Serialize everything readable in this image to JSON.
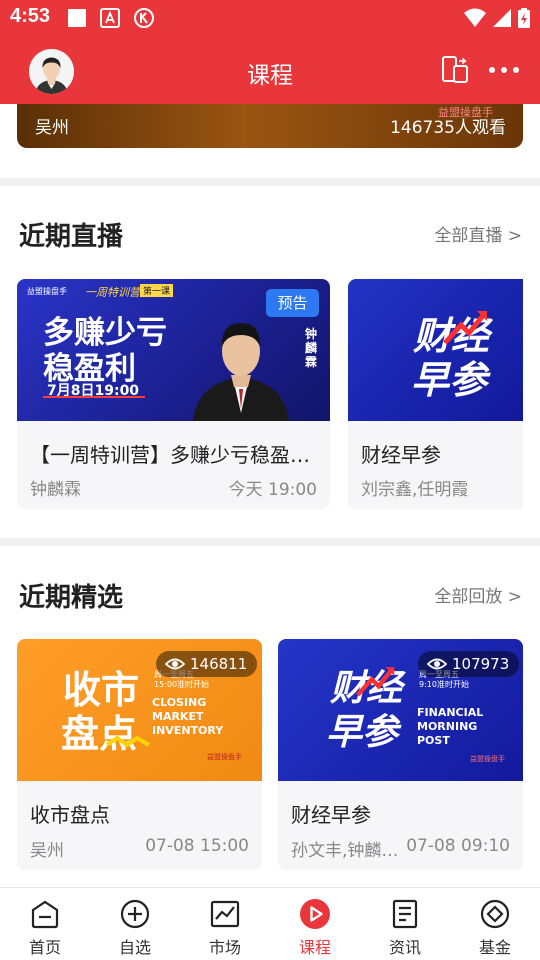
{
  "status_bar": {
    "time": "4:53"
  },
  "header": {
    "title": "课程"
  },
  "banner": {
    "location": "吴州",
    "views": "146735人观看",
    "logo_text": "益盟操盘手"
  },
  "live": {
    "title": "近期直播",
    "more": "全部直播 >",
    "cards": [
      {
        "badge": "预告",
        "title": "【一周特训营】多赚少亏稳盈…",
        "host": "钟麟霖",
        "time": "今天 19:00",
        "thumb": {
          "top_brand": "益盟操盘手",
          "camp": "一周特训营",
          "episode": "第一课",
          "line1": "多赚少亏",
          "line2": "稳盈利",
          "date": "7月8日19:00",
          "name": "钟麟霖"
        }
      },
      {
        "title": "财经早参",
        "host": "刘宗鑫,任明霞",
        "thumb": {
          "line1": "财经",
          "line2": "早参"
        }
      }
    ]
  },
  "featured": {
    "title": "近期精选",
    "more": "全部回放 >",
    "cards": [
      {
        "views": "146811",
        "title": "收市盘点",
        "host": "吴州",
        "time": "07-08 15:00",
        "thumb": {
          "line1": "收市",
          "line2": "盘点",
          "sched1": "周一至周五",
          "sched2": "15:00准时开始",
          "en1": "CLOSING",
          "en2": "MARKET",
          "en3": "INVENTORY",
          "brand": "益盟操盘手"
        }
      },
      {
        "views": "107973",
        "title": "财经早参",
        "host": "孙文丰,钟麟…",
        "time": "07-08 09:10",
        "thumb": {
          "line1": "财经",
          "line2": "早参",
          "sched1": "周一至周五",
          "sched2": "9:10准时开始",
          "en1": "FINANCIAL",
          "en2": "MORNING",
          "en3": "POST",
          "brand": "益盟操盘手"
        }
      }
    ]
  },
  "nav": [
    {
      "label": "首页",
      "icon": "home-icon"
    },
    {
      "label": "自选",
      "icon": "plus-circle-icon"
    },
    {
      "label": "市场",
      "icon": "chart-icon"
    },
    {
      "label": "课程",
      "icon": "play-icon",
      "active": true
    },
    {
      "label": "资讯",
      "icon": "news-icon"
    },
    {
      "label": "基金",
      "icon": "fund-icon"
    }
  ],
  "colors": {
    "brand": "#E8363B",
    "accent_blue": "#2c79f2",
    "thumb_blue": "#1a2bb0",
    "thumb_orange": "#f5901e"
  }
}
